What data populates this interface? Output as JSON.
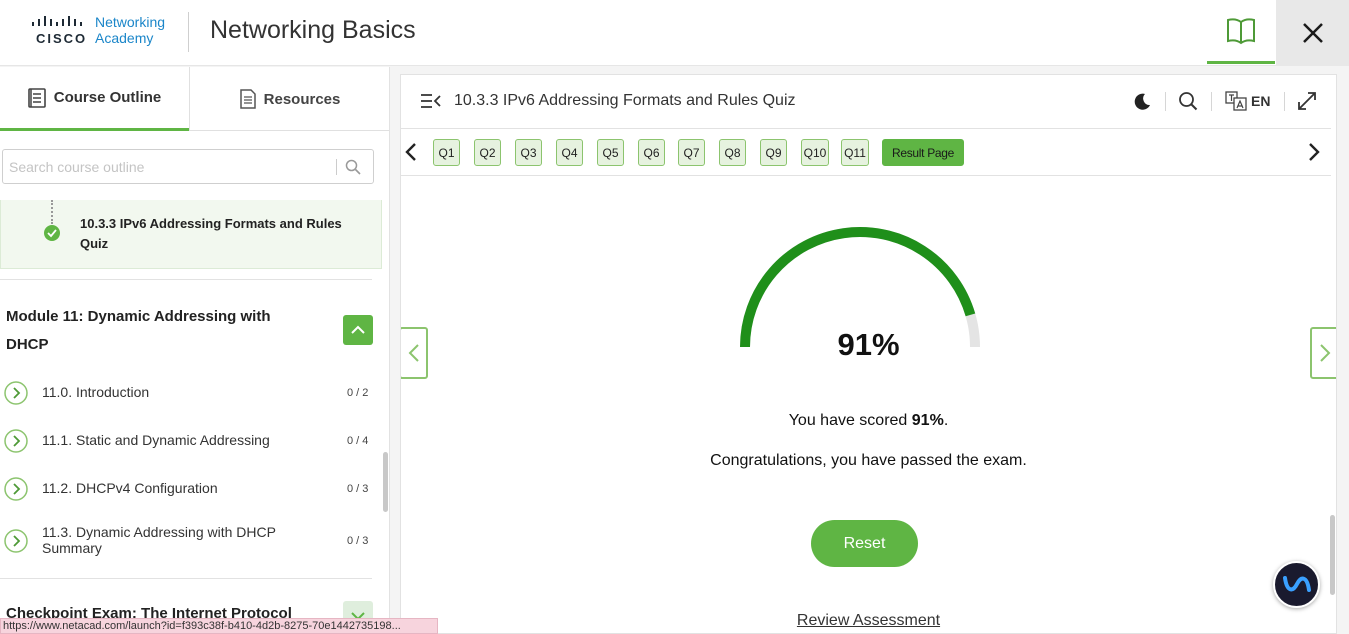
{
  "header": {
    "logo_word": "CISCO",
    "logo_line1": "Networking",
    "logo_line2": "Academy",
    "app_title": "Networking Basics"
  },
  "sidebar": {
    "tabs": [
      {
        "label": "Course Outline"
      },
      {
        "label": "Resources"
      }
    ],
    "search_placeholder": "Search course outline",
    "current_item": "10.3.3 IPv6 Addressing Formats and Rules Quiz",
    "module_title": "Module 11: Dynamic Addressing with DHCP",
    "lessons": [
      {
        "title": "11.0. Introduction",
        "progress": "0 / 2"
      },
      {
        "title": "11.1. Static and Dynamic Addressing",
        "progress": "0 / 4"
      },
      {
        "title": "11.2. DHCPv4 Configuration",
        "progress": "0 / 3"
      },
      {
        "title": "11.3. Dynamic Addressing with DHCP Summary",
        "progress": "0 / 3"
      }
    ],
    "checkpoint_title": "Checkpoint Exam: The Internet Protocol"
  },
  "main": {
    "title": "10.3.3 IPv6 Addressing Formats and Rules Quiz",
    "language": "EN",
    "questions": [
      "Q1",
      "Q2",
      "Q3",
      "Q4",
      "Q5",
      "Q6",
      "Q7",
      "Q8",
      "Q9",
      "Q10",
      "Q11"
    ],
    "result_label": "Result Page",
    "score_fraction": 0.91,
    "score_text": "91%",
    "scored_prefix": "You have scored ",
    "scored_value": "91%",
    "scored_suffix": ".",
    "congrats": "Congratulations, you have passed the exam.",
    "reset_label": "Reset",
    "review_label": "Review Assessment"
  },
  "colors": {
    "accent": "#5fb544",
    "gauge_fill": "#1f8f1a",
    "gauge_track": "#e4e4e4",
    "brand_blue": "#1b86c9"
  },
  "status_url": "https://www.netacad.com/launch?id=f393c38f-b410-4d2b-8275-70e1442735198..."
}
